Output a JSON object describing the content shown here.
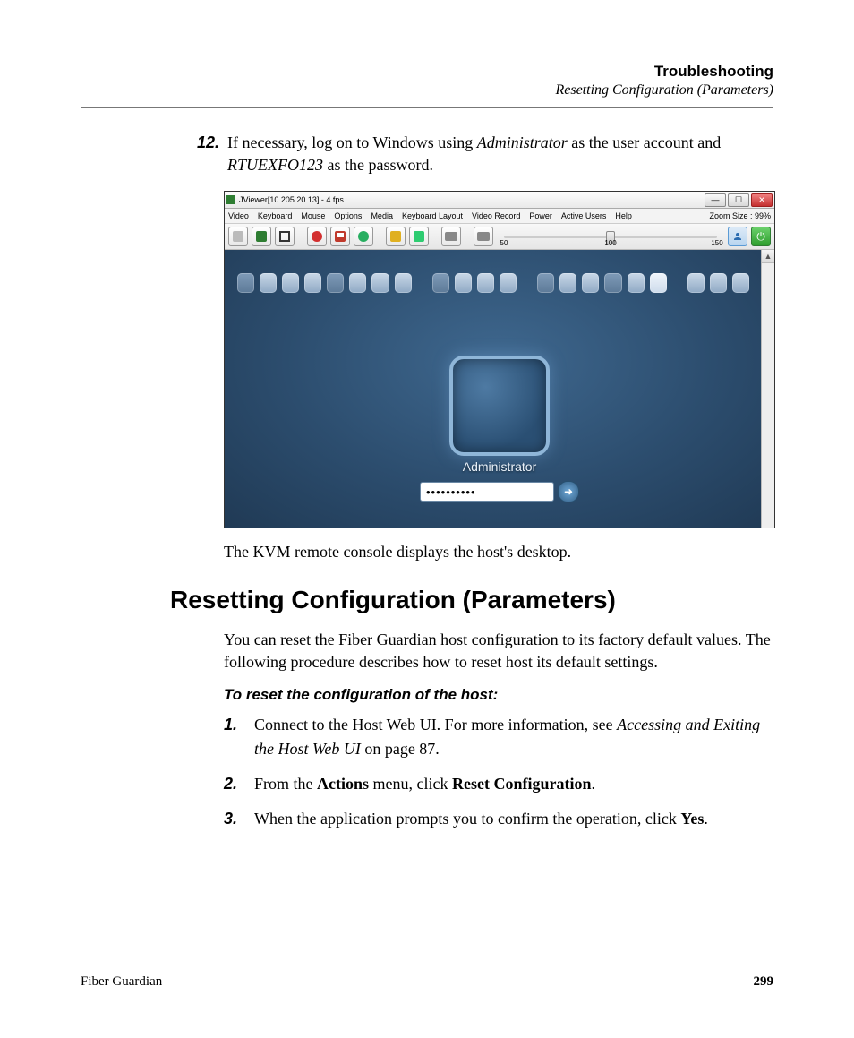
{
  "header": {
    "title": "Troubleshooting",
    "subtitle": "Resetting Configuration (Parameters)"
  },
  "step12": {
    "number": "12.",
    "prefix": "If necessary, log on to Windows using ",
    "admin": "Administrator",
    "mid": " as the user account and ",
    "pwd": "RTUEXFO123",
    "suffix": " as the password."
  },
  "screenshot": {
    "window_title": "JViewer[10.205.20.13] - 4 fps",
    "menus": [
      "Video",
      "Keyboard",
      "Mouse",
      "Options",
      "Media",
      "Keyboard Layout",
      "Video Record",
      "Power",
      "Active Users",
      "Help"
    ],
    "zoom_label": "Zoom Size : 99%",
    "slider_ticks": [
      "50",
      "100",
      "150"
    ],
    "login_user": "Administrator",
    "password_mask": "••••••••••",
    "icons": {
      "play": "play-icon",
      "fullscreen": "fullscreen-icon",
      "record": "record-icon",
      "save": "save-icon",
      "stop": "stop-icon",
      "settings1": "settings-icon",
      "settings2": "settings-icon-2",
      "keyboard": "keyboard-icon",
      "keyboard2": "keyboard-icon-2",
      "user": "user-icon",
      "power": "power-icon",
      "submit": "submit-arrow-icon"
    }
  },
  "caption": "The KVM remote console displays the host's desktop.",
  "section_heading": "Resetting Configuration (Parameters)",
  "intro": "You can reset the Fiber Guardian host configuration to its factory default values. The following procedure describes how to reset host its default settings.",
  "subhead": "To reset the configuration of the host:",
  "steps": [
    {
      "num": "1.",
      "pre": "Connect to the Host Web UI. For more information, see ",
      "em": "Accessing and Exiting the Host Web UI",
      "post": " on page 87."
    },
    {
      "num": "2.",
      "pre": "From the ",
      "b1": "Actions",
      "mid": " menu, click ",
      "b2": "Reset Configuration",
      "post": "."
    },
    {
      "num": "3.",
      "pre": "When the application prompts you to confirm the operation, click ",
      "b1": "Yes",
      "post": "."
    }
  ],
  "footer": {
    "left": "Fiber Guardian",
    "page": "299"
  }
}
